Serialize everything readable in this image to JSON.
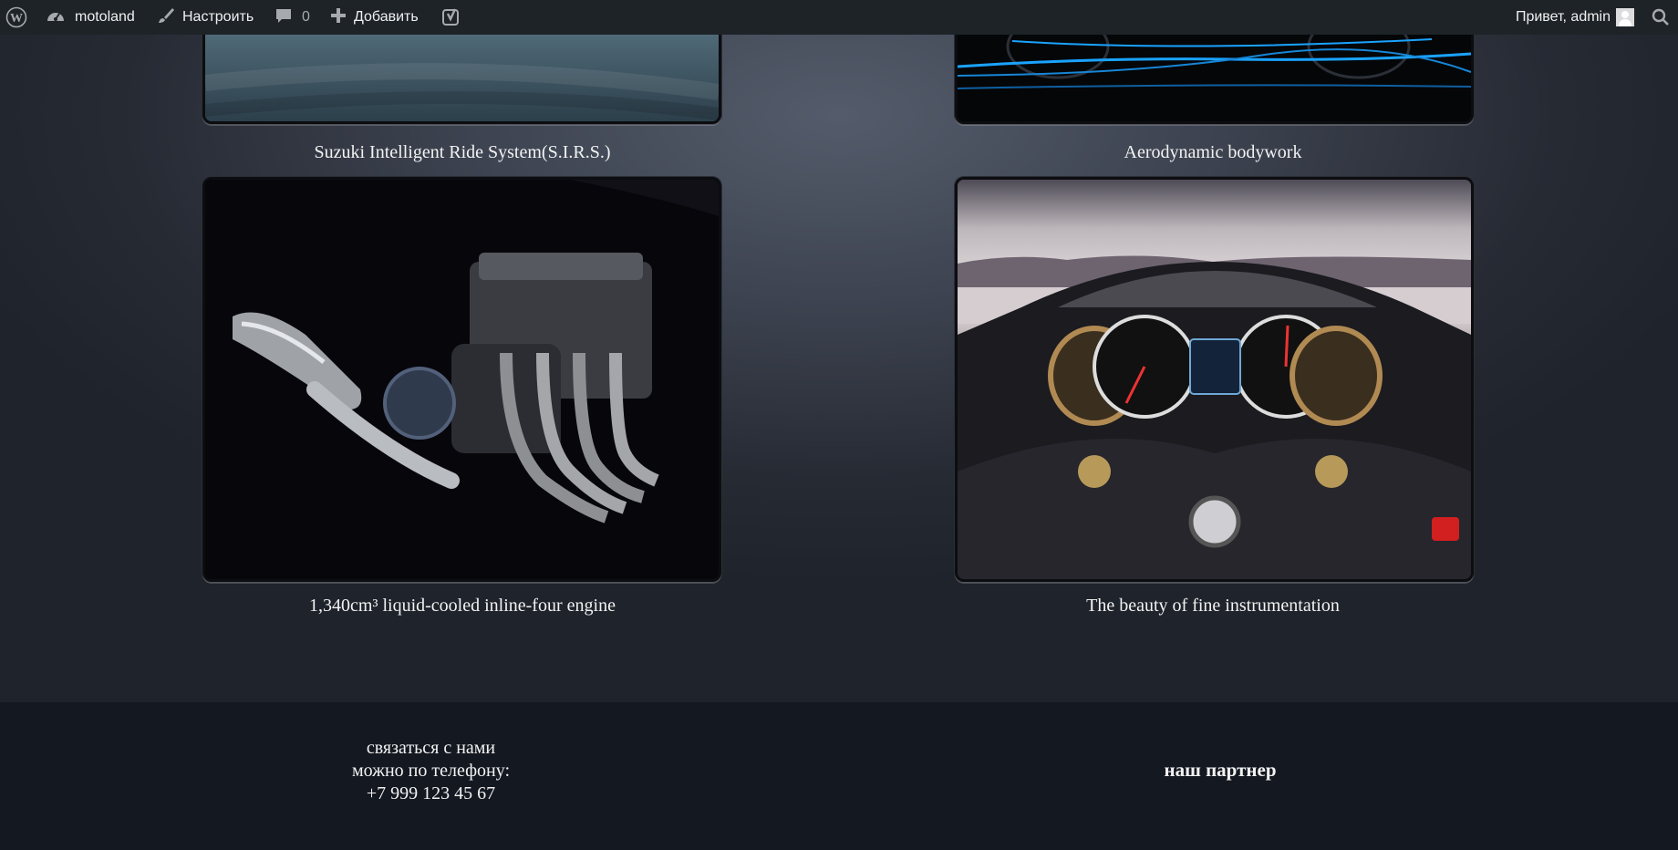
{
  "admin_bar": {
    "site_name": "motoland",
    "customize_label": "Настроить",
    "comments_count": "0",
    "new_label": "Добавить",
    "greeting": "Привет, admin",
    "icons": [
      "wordpress-logo-icon",
      "dashboard-icon",
      "brush-icon",
      "comment-icon",
      "plus-icon",
      "yoast-icon",
      "avatar",
      "search-icon"
    ]
  },
  "gallery": {
    "items": [
      {
        "caption": "Suzuki Intelligent Ride System(S.I.R.S.)"
      },
      {
        "caption": "Aerodynamic bodywork"
      },
      {
        "caption": "1,340cm³ liquid-cooled inline-four engine"
      },
      {
        "caption": "The beauty of fine instrumentation"
      }
    ]
  },
  "footer": {
    "contact_line1": "связаться с нами",
    "contact_line2": "можно по телефону:",
    "contact_phone": "+7 999 123 45 67",
    "partner_label": "наш партнер"
  },
  "colors": {
    "admin_bar_bg": "#1d2327",
    "page_bg": "#20242d",
    "footer_bg": "#141821",
    "text": "#f2f2f2"
  }
}
